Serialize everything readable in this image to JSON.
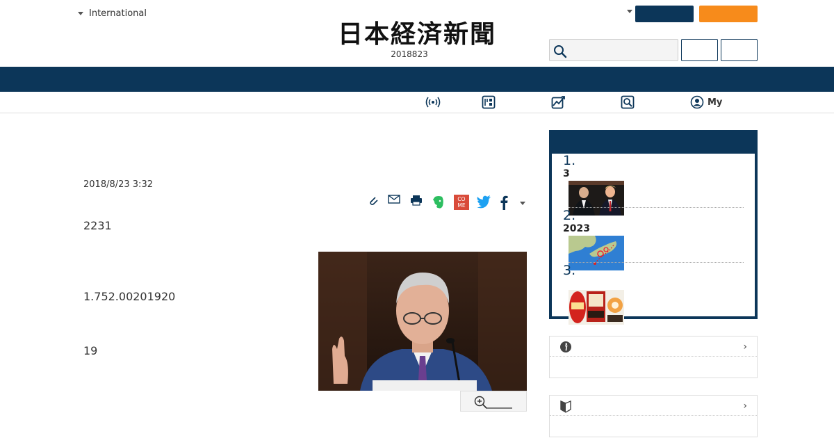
{
  "header": {
    "edition_label": "International",
    "logo_text": "日本経済新聞",
    "date_text": "2018823",
    "subnav_my_label": "My"
  },
  "article": {
    "date": "2018/8/23 3:32",
    "para1": "2231",
    "para2": "1.752.00201920",
    "para3": "19"
  },
  "ranking": {
    "items": [
      {
        "num": "1.",
        "title": "3"
      },
      {
        "num": "2.",
        "title": "2023"
      },
      {
        "num": "3.",
        "title": ""
      }
    ]
  },
  "colors": {
    "navy": "#0c3659",
    "orange": "#f78b1b"
  },
  "icons": {
    "subnav": [
      "broadcast-icon",
      "newspaper-icon",
      "chart-icon",
      "search-news-icon",
      "user-icon"
    ],
    "share": [
      "clip-icon",
      "mail-icon",
      "print-icon",
      "evernote-icon",
      "come-icon",
      "twitter-icon",
      "facebook-icon",
      "more-dropdown-icon"
    ],
    "panels": [
      "info-icon",
      "beginner-icon"
    ]
  }
}
